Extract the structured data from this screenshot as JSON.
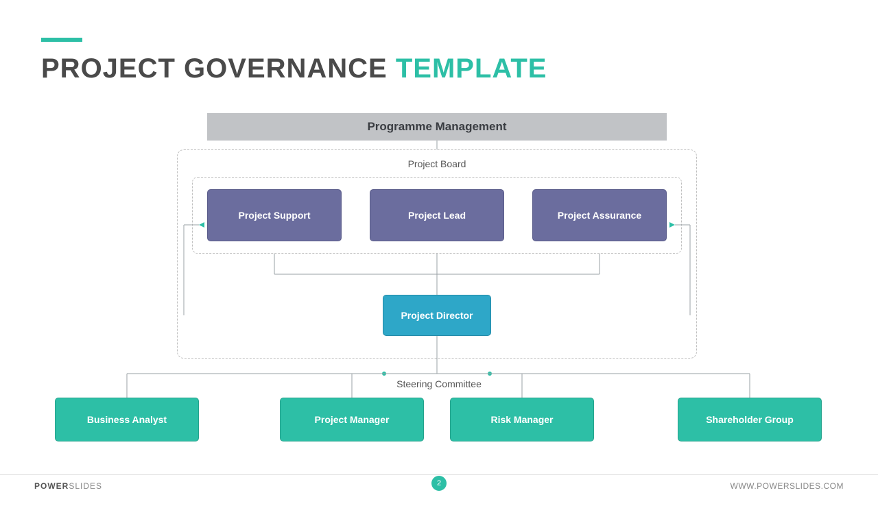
{
  "title": {
    "main": "PROJECT GOVERNANCE",
    "accent": "TEMPLATE"
  },
  "programme_band": "Programme Management",
  "board": {
    "container_label": "Project Board",
    "support": "Project Support",
    "lead": "Project Lead",
    "assurance": "Project Assurance"
  },
  "director": "Project Director",
  "steering_label": "Steering Committee",
  "steering": {
    "ba": "Business Analyst",
    "pm": "Project Manager",
    "risk": "Risk Manager",
    "shg": "Shareholder Group"
  },
  "footer": {
    "brand_bold": "POWER",
    "brand_light": "SLIDES",
    "page": "2",
    "url": "WWW.POWERSLIDES.COM"
  },
  "colors": {
    "accent": "#2dbfa6",
    "purple": "#6b6d9e",
    "cyan": "#2ea7c8",
    "band": "#c1c3c6"
  }
}
